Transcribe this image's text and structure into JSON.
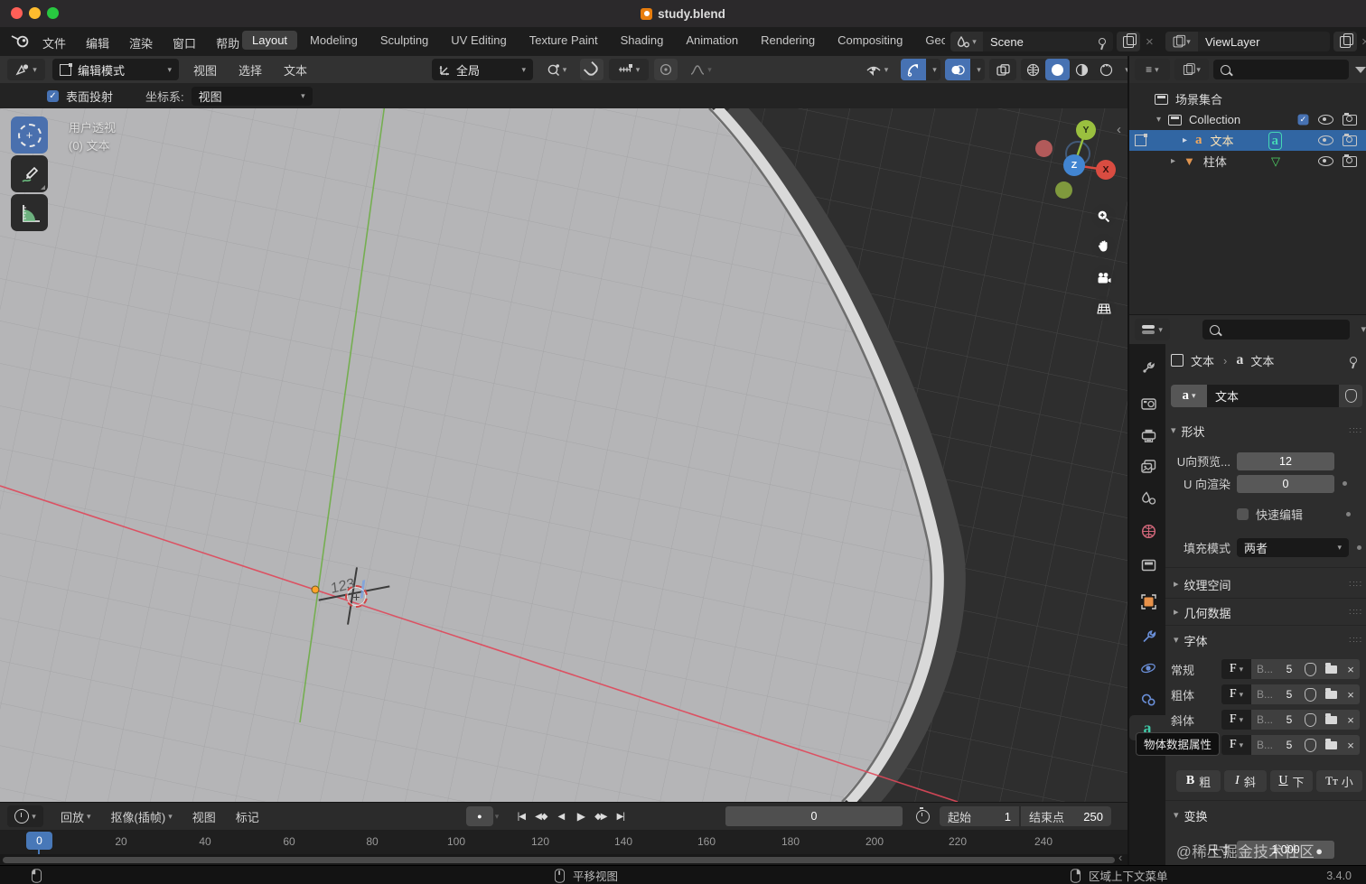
{
  "window": {
    "title": "study.blend"
  },
  "icons": {
    "dropdown": "▾",
    "disc_open": "▾",
    "disc_closed": "▸",
    "close": "×",
    "sep": "›",
    "grip": "∷∷",
    "collapse": "‹",
    "check": "✓",
    "plus": "+",
    "record": "●",
    "play": "▶",
    "play_back": "◀",
    "jump_start": "|◀",
    "jump_end": "▶|",
    "prev_key": "◀◆",
    "next_key": "◆▶",
    "text_data": "a",
    "menu": "≡",
    "cone": "▼",
    "mesh_tri": "▽"
  },
  "topbar": {
    "menus": [
      {
        "label": "文件"
      },
      {
        "label": "编辑"
      },
      {
        "label": "渲染"
      },
      {
        "label": "窗口"
      },
      {
        "label": "帮助"
      }
    ],
    "workspaces": [
      {
        "label": "Layout"
      },
      {
        "label": "Modeling"
      },
      {
        "label": "Sculpting"
      },
      {
        "label": "UV Editing"
      },
      {
        "label": "Texture Paint"
      },
      {
        "label": "Shading"
      },
      {
        "label": "Animation"
      },
      {
        "label": "Rendering"
      },
      {
        "label": "Compositing"
      },
      {
        "label": "Geometry Nodes"
      }
    ],
    "scene": "Scene",
    "view_layer": "ViewLayer"
  },
  "tool_header": {
    "mode": "编辑模式",
    "menus": [
      {
        "label": "视图"
      },
      {
        "label": "选择"
      },
      {
        "label": "文本"
      }
    ],
    "orientation": "全局"
  },
  "tool_settings": {
    "surface_project": "表面投射",
    "coord_label": "坐标系:",
    "coord_value": "视图"
  },
  "viewport": {
    "overlay_line1": "用户透视",
    "overlay_line2": "(0) 文本",
    "edit_text": "123",
    "axis_x": "X",
    "axis_y": "Y",
    "axis_z": "Z"
  },
  "outliner": {
    "scene_collection": "场景集合",
    "collection": "Collection",
    "objects": [
      {
        "name": "文本"
      },
      {
        "name": "柱体"
      }
    ]
  },
  "properties": {
    "breadcrumb": {
      "object": "文本",
      "data": "文本"
    },
    "id_name": "文本",
    "shape": {
      "title": "形状",
      "preview_label": "U向预览...",
      "preview_value": "12",
      "render_label": "U 向渲染",
      "render_value": "0",
      "fast_label": "快速编辑",
      "fill_label": "填充模式",
      "fill_value": "两者"
    },
    "texture": {
      "title": "纹理空间"
    },
    "geometry": {
      "title": "几何数据"
    },
    "font": {
      "title": "字体",
      "rows": [
        {
          "label": "常规"
        },
        {
          "label": "粗体"
        },
        {
          "label": "斜体"
        },
        {
          "label": ""
        }
      ],
      "f_icon": "F",
      "name": "B...",
      "size": "5"
    },
    "style": [
      {
        "icon": "B",
        "label": "粗"
      },
      {
        "icon": "I",
        "label": "斜"
      },
      {
        "icon": "U",
        "label": "下"
      },
      {
        "icon": "Tт",
        "label": "小"
      }
    ],
    "transform": {
      "title": "变换",
      "size_label": "尺寸",
      "size_value": "1.000"
    },
    "tooltip": "物体数据属性"
  },
  "timeline": {
    "menus": [
      {
        "label": "回放"
      },
      {
        "label": "抠像(插帧)"
      },
      {
        "label": "视图"
      },
      {
        "label": "标记"
      }
    ],
    "frame": "0",
    "playhead": "0",
    "start_label": "起始",
    "start": "1",
    "end_label": "结束点",
    "end": "250",
    "ruler": [
      "20",
      "40",
      "60",
      "80",
      "100",
      "120",
      "140",
      "160",
      "180",
      "200",
      "220",
      "240"
    ]
  },
  "status": {
    "pan": "平移视图",
    "context_menu": "区域上下文菜单",
    "version": "3.4.0",
    "watermark": "@稀土掘金技术社区"
  }
}
